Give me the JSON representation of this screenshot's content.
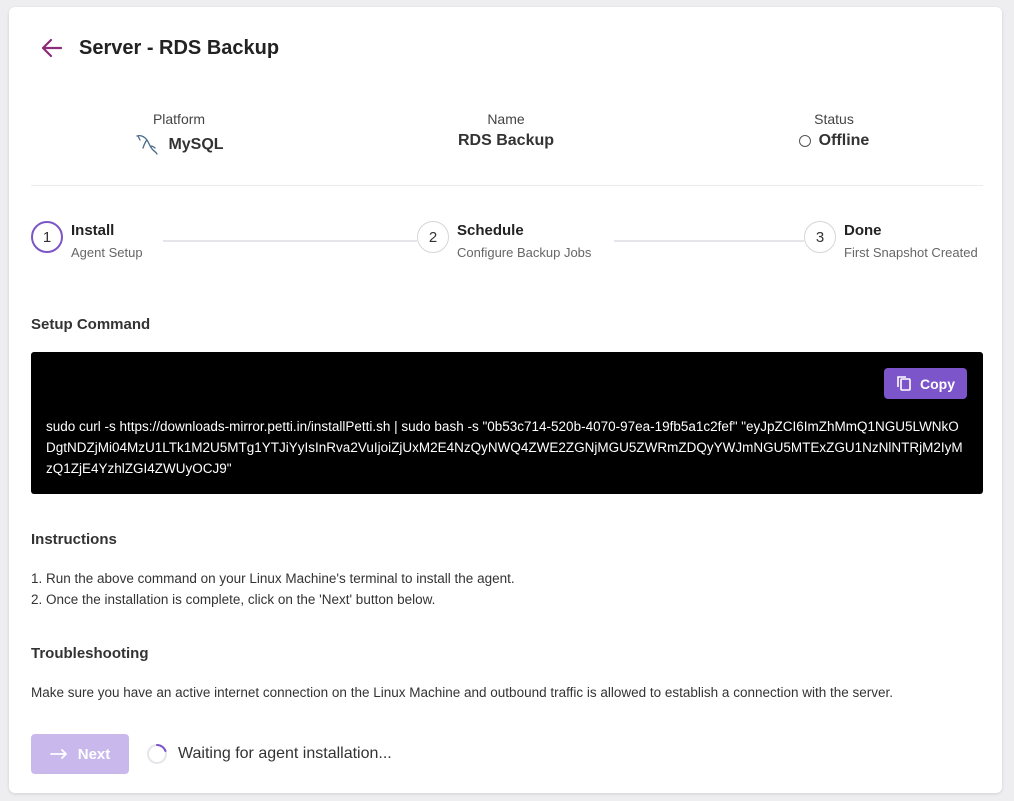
{
  "header": {
    "title": "Server - RDS Backup"
  },
  "info": {
    "platform": {
      "label": "Platform",
      "value": "MySQL"
    },
    "name": {
      "label": "Name",
      "value": "RDS Backup"
    },
    "status": {
      "label": "Status",
      "value": "Offline"
    }
  },
  "steps": [
    {
      "number": "1",
      "title": "Install",
      "subtitle": "Agent Setup"
    },
    {
      "number": "2",
      "title": "Schedule",
      "subtitle": "Configure Backup Jobs"
    },
    {
      "number": "3",
      "title": "Done",
      "subtitle": "First Snapshot Created"
    }
  ],
  "setup": {
    "title": "Setup Command",
    "copy_label": "Copy",
    "command": "sudo curl -s https://downloads-mirror.petti.in/installPetti.sh | sudo bash -s \"0b53c714-520b-4070-97ea-19fb5a1c2fef\" \"eyJpZCI6ImZhMmQ1NGU5LWNkODgtNDZjMi04MzU1LTk1M2U5MTg1YTJiYyIsInRva2VuIjoiZjUxM2E4NzQyNWQ4ZWE2ZGNjMGU5ZWRmZDQyYWJmNGU5MTExZGU1NzNlNTRjM2IyMzQ1ZjE4YzhlZGI4ZWUyOCJ9\""
  },
  "instructions": {
    "title": "Instructions",
    "lines": [
      "1. Run the above command on your Linux Machine's terminal to install the agent.",
      "2. Once the installation is complete, click on the 'Next' button below."
    ]
  },
  "troubleshooting": {
    "title": "Troubleshooting",
    "text": "Make sure you have an active internet connection on the Linux Machine and outbound traffic is allowed to establish a connection with the server."
  },
  "footer": {
    "next_label": "Next",
    "waiting_text": "Waiting for agent installation..."
  },
  "colors": {
    "accent": "#7b55c9",
    "accent_disabled": "#c8b8ec",
    "back_arrow": "#8b2b7a"
  }
}
